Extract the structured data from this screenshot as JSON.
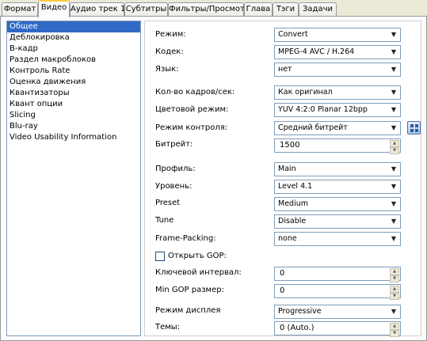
{
  "tabs": [
    "Формат",
    "Видео",
    "Аудио трек 1",
    "Субтитры",
    "Фильтры/Просмотр",
    "Глава",
    "Тэги",
    "Задачи"
  ],
  "active_tab": 1,
  "sidebar": {
    "items": [
      "Общее",
      "Деблокировка",
      "В-кадр",
      "Раздел макроблоков",
      "Контроль Rate",
      "Оценка движения",
      "Квантизаторы",
      "Квант опции",
      "Slicing",
      "Blu-ray",
      "Video Usability Information"
    ],
    "selected": 0
  },
  "form": {
    "mode": {
      "label": "Режим:",
      "value": "Convert"
    },
    "codec": {
      "label": "Кодек:",
      "value": "MPEG-4 AVC / H.264"
    },
    "language": {
      "label": "Язык:",
      "value": "нет"
    },
    "fps": {
      "label": "Кол-во кадров/сек:",
      "value": "Как оригинал"
    },
    "color_mode": {
      "label": "Цветовой режим:",
      "value": "YUV 4:2:0 Planar 12bpp"
    },
    "control_mode": {
      "label": "Режим контроля:",
      "value": "Средний битрейт"
    },
    "bitrate": {
      "label": "Битрейт:",
      "value": "1500"
    },
    "profile": {
      "label": "Профиль:",
      "value": "Main"
    },
    "level": {
      "label": "Уровень:",
      "value": "Level 4.1"
    },
    "preset": {
      "label": "Preset",
      "value": "Medium"
    },
    "tune": {
      "label": "Tune",
      "value": "Disable"
    },
    "frame_packing": {
      "label": "Frame-Packing:",
      "value": "none"
    },
    "open_gop": {
      "label": "Открыть GOP:",
      "checked": false
    },
    "keyframe_interval": {
      "label": "Ключевой интервал:",
      "value": "0"
    },
    "min_gop": {
      "label": "Min GOP размер:",
      "value": "0"
    },
    "display_mode": {
      "label": "Режим дисплея",
      "value": "Progressive"
    },
    "themes": {
      "label": "Темы:",
      "value": "0 (Auto.)"
    }
  },
  "icons": {
    "dropdown": "chevron-down-icon",
    "spin_up": "spin-up-icon",
    "spin_down": "spin-down-icon",
    "settings_grid": "grid-settings-icon"
  },
  "colors": {
    "selection": "#316ac5",
    "active_tab_accent": "#ffc83c",
    "window_bg": "#ece9d8"
  }
}
